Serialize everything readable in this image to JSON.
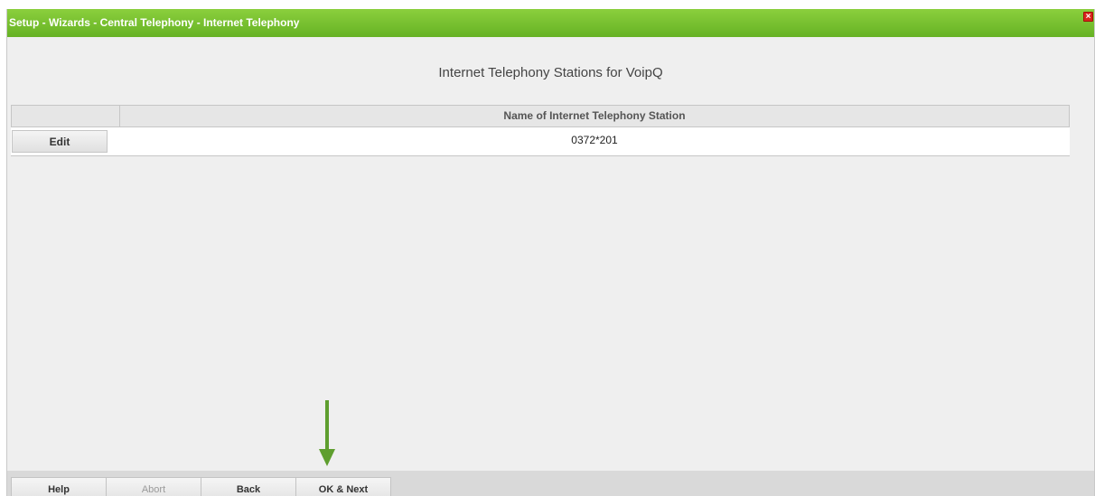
{
  "window": {
    "title": "Setup - Wizards - Central Telephony - Internet Telephony",
    "close_label": "×"
  },
  "main": {
    "heading": "Internet Telephony Stations for VoipQ",
    "table": {
      "columns": [
        "",
        "Name of Internet Telephony Station"
      ],
      "rows": [
        {
          "action": "Edit",
          "name": "0372*201"
        }
      ]
    }
  },
  "footer": {
    "buttons": [
      {
        "label": "Help",
        "enabled": true
      },
      {
        "label": "Abort",
        "enabled": false
      },
      {
        "label": "Back",
        "enabled": true
      },
      {
        "label": "OK & Next",
        "enabled": true
      }
    ]
  },
  "annotation": {
    "arrow_color": "#5e9e2e",
    "points_to": "OK & Next"
  },
  "colors": {
    "titlebar": "#6dbb2a",
    "close": "#d9251c"
  }
}
